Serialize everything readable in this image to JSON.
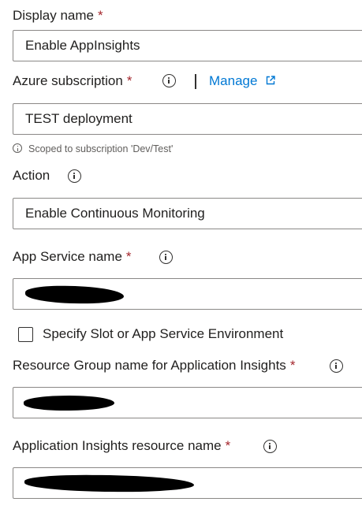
{
  "form": {
    "display_name": {
      "label": "Display name",
      "required_mark": "*",
      "value": "Enable AppInsights"
    },
    "azure_subscription": {
      "label": "Azure subscription",
      "required_mark": "*",
      "manage_link": "Manage",
      "value": "TEST deployment",
      "helper_text": "Scoped to subscription 'Dev/Test'"
    },
    "action": {
      "label": "Action",
      "value": "Enable Continuous Monitoring"
    },
    "app_service_name": {
      "label": "App Service name",
      "required_mark": "*",
      "value_redacted": true
    },
    "slot_checkbox": {
      "label": "Specify Slot or App Service Environment",
      "checked": false
    },
    "resource_group": {
      "label": "Resource Group name for Application Insights",
      "required_mark": "*",
      "value_redacted": true
    },
    "app_insights_resource": {
      "label": "Application Insights resource name",
      "required_mark": "*",
      "value_redacted": true
    }
  },
  "colors": {
    "required": "#a4262c",
    "link": "#0078d4",
    "border": "#8a8886",
    "text": "#201f1e",
    "helper": "#605e5c"
  }
}
